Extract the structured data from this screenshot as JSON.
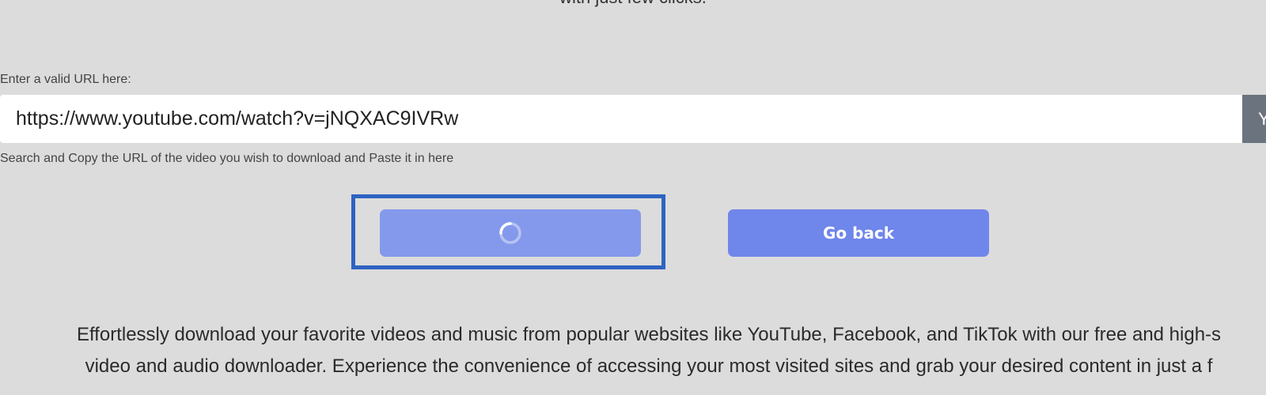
{
  "header": {
    "subtitle": "with just few clicks."
  },
  "form": {
    "url_label": "Enter a valid URL here:",
    "url_value": "https://www.youtube.com/watch?v=jNQXAC9IVRw",
    "addon_text": "Y",
    "help_text": "Search and Copy the URL of the video you wish to download and Paste it in here",
    "back_button_label": "Go back",
    "submit_state": "loading"
  },
  "icons": {
    "submit_spinner": "loading-spinner-icon"
  },
  "colors": {
    "background": "#dcdcdc",
    "primary_button": "#6f86ea",
    "primary_button_loading": "#8599ec",
    "focus_frame": "#2e63c2",
    "addon": "#6b737e"
  },
  "description": {
    "line1": "Effortlessly download your favorite videos and music from popular websites like YouTube, Facebook, and TikTok with our free and high-s",
    "line2": "video and audio downloader. Experience the convenience of accessing your most visited sites and grab your desired content in just a f"
  }
}
